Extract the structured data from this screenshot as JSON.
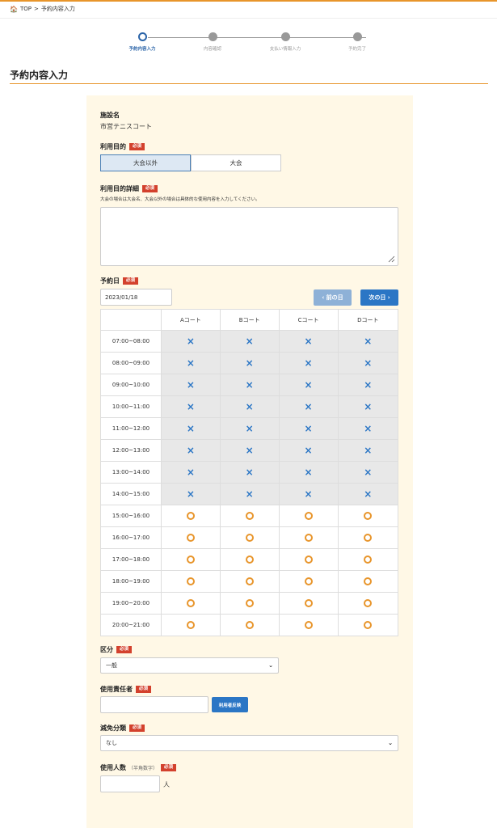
{
  "breadcrumb": {
    "home": "TOP",
    "separator": ">",
    "current": "予約内容入力"
  },
  "steps": [
    {
      "label": "予約内容入力",
      "active": true
    },
    {
      "label": "内容確認",
      "active": false
    },
    {
      "label": "支払い情報入力",
      "active": false
    },
    {
      "label": "予約完了",
      "active": false
    }
  ],
  "page_title": "予約内容入力",
  "required_badge": "必須",
  "facility": {
    "label": "施設名",
    "value": "市営テニスコート"
  },
  "purpose": {
    "label": "利用目的",
    "options": [
      "大会以外",
      "大会"
    ],
    "selected": "大会以外"
  },
  "purpose_detail": {
    "label": "利用目的詳細",
    "note": "大会の場合は大会名、大会以外の場合は具体的な使用内容を入力してください。",
    "value": ""
  },
  "reserve_date": {
    "label": "予約日",
    "value": "2023/01/18",
    "prev_label": "‹ 前の日",
    "next_label": "次の日 ›"
  },
  "availability": {
    "columns": [
      "Aコート",
      "Bコート",
      "Cコート",
      "Dコート"
    ],
    "rows": [
      {
        "time": "07:00~08:00",
        "status": [
          "×",
          "×",
          "×",
          "×"
        ]
      },
      {
        "time": "08:00~09:00",
        "status": [
          "×",
          "×",
          "×",
          "×"
        ]
      },
      {
        "time": "09:00~10:00",
        "status": [
          "×",
          "×",
          "×",
          "×"
        ]
      },
      {
        "time": "10:00~11:00",
        "status": [
          "×",
          "×",
          "×",
          "×"
        ]
      },
      {
        "time": "11:00~12:00",
        "status": [
          "×",
          "×",
          "×",
          "×"
        ]
      },
      {
        "time": "12:00~13:00",
        "status": [
          "×",
          "×",
          "×",
          "×"
        ]
      },
      {
        "time": "13:00~14:00",
        "status": [
          "×",
          "×",
          "×",
          "×"
        ]
      },
      {
        "time": "14:00~15:00",
        "status": [
          "×",
          "×",
          "×",
          "×"
        ]
      },
      {
        "time": "15:00~16:00",
        "status": [
          "○",
          "○",
          "○",
          "○"
        ]
      },
      {
        "time": "16:00~17:00",
        "status": [
          "○",
          "○",
          "○",
          "○"
        ]
      },
      {
        "time": "17:00~18:00",
        "status": [
          "○",
          "○",
          "○",
          "○"
        ]
      },
      {
        "time": "18:00~19:00",
        "status": [
          "○",
          "○",
          "○",
          "○"
        ]
      },
      {
        "time": "19:00~20:00",
        "status": [
          "○",
          "○",
          "○",
          "○"
        ]
      },
      {
        "time": "20:00~21:00",
        "status": [
          "○",
          "○",
          "○",
          "○"
        ]
      }
    ]
  },
  "category": {
    "label": "区分",
    "value": "一般"
  },
  "responsible": {
    "label": "使用責任者",
    "value": "",
    "button_label": "利用者反映"
  },
  "discount": {
    "label": "減免分類",
    "value": "なし"
  },
  "people": {
    "label": "使用人数",
    "sub": "（半角数字）",
    "value": "",
    "unit": "人"
  },
  "colors": {
    "accent": "#e8952b",
    "primary": "#2b76c5",
    "required": "#d3412d",
    "panel": "#fff8e6"
  }
}
